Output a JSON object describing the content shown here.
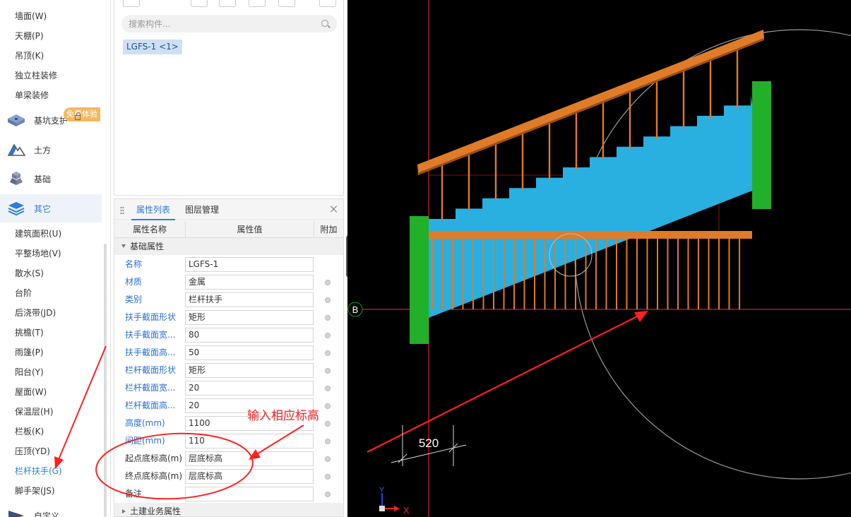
{
  "nav": {
    "top_items": [
      "墙面(W)",
      "天棚(P)",
      "吊顶(K)",
      "独立柱装修",
      "单梁装修"
    ],
    "categories": [
      {
        "label": "基坑支护",
        "icon": "foundation-pit-icon"
      },
      {
        "label": "土方",
        "icon": "earthwork-icon"
      },
      {
        "label": "基础",
        "icon": "foundation-icon"
      },
      {
        "label": "其它",
        "icon": "layers-icon",
        "active": true
      },
      {
        "label": "自定义",
        "icon": "custom-icon"
      }
    ],
    "free_trial_badge": "免费体验",
    "other_items": [
      "建筑面积(U)",
      "平整场地(V)",
      "散水(S)",
      "台阶",
      "后浇带(JD)",
      "挑檐(T)",
      "雨篷(P)",
      "阳台(Y)",
      "屋面(W)",
      "保温层(H)",
      "栏板(K)",
      "压顶(YD)",
      "栏杆扶手(G)",
      "脚手架(JS)"
    ],
    "active_item": "栏杆扶手(G)"
  },
  "component_panel": {
    "search_placeholder": "搜索构件...",
    "selected_component": "LGFS-1 <1>"
  },
  "property_panel": {
    "tabs": [
      "属性列表",
      "图层管理"
    ],
    "columns": [
      "属性名称",
      "属性值",
      "附加"
    ],
    "group_basic": "基础属性",
    "rows": [
      {
        "name": "名称",
        "value": "LGFS-1",
        "checkbox": false,
        "black": false
      },
      {
        "name": "材质",
        "value": "金属",
        "checkbox": true,
        "black": false
      },
      {
        "name": "类别",
        "value": "栏杆扶手",
        "checkbox": true,
        "black": false
      },
      {
        "name": "扶手截面形状",
        "value": "矩形",
        "checkbox": true,
        "black": false
      },
      {
        "name": "扶手截面宽...",
        "value": "80",
        "checkbox": true,
        "black": false
      },
      {
        "name": "扶手截面高...",
        "value": "50",
        "checkbox": true,
        "black": false
      },
      {
        "name": "栏杆截面形状",
        "value": "矩形",
        "checkbox": true,
        "black": false
      },
      {
        "name": "栏杆截面宽...",
        "value": "20",
        "checkbox": true,
        "black": false
      },
      {
        "name": "栏杆截面高...",
        "value": "20",
        "checkbox": true,
        "black": false
      },
      {
        "name": "高度(mm)",
        "value": "1100",
        "checkbox": true,
        "black": false
      },
      {
        "name": "间距(mm)",
        "value": "110",
        "checkbox": true,
        "black": false
      },
      {
        "name": "起点底标高(m)",
        "value": "层底标高",
        "checkbox": true,
        "black": true
      },
      {
        "name": "终点底标高(m)",
        "value": "层底标高",
        "checkbox": true,
        "black": true
      },
      {
        "name": "备注",
        "value": "",
        "checkbox": true,
        "black": true
      }
    ],
    "group_civil": "土建业务属性"
  },
  "viewport": {
    "axis_label": "B",
    "dimension_label": "520",
    "annotation": "输入相应标高",
    "axis_x": "X",
    "axis_y": "Y"
  },
  "colors": {
    "accent": "#2b7be0",
    "annotation_red": "#ff2020",
    "stair_blue": "#29afe0",
    "rail_orange": "#e07b28",
    "wall_green": "#22b02a",
    "viewport_bg": "#000000"
  }
}
